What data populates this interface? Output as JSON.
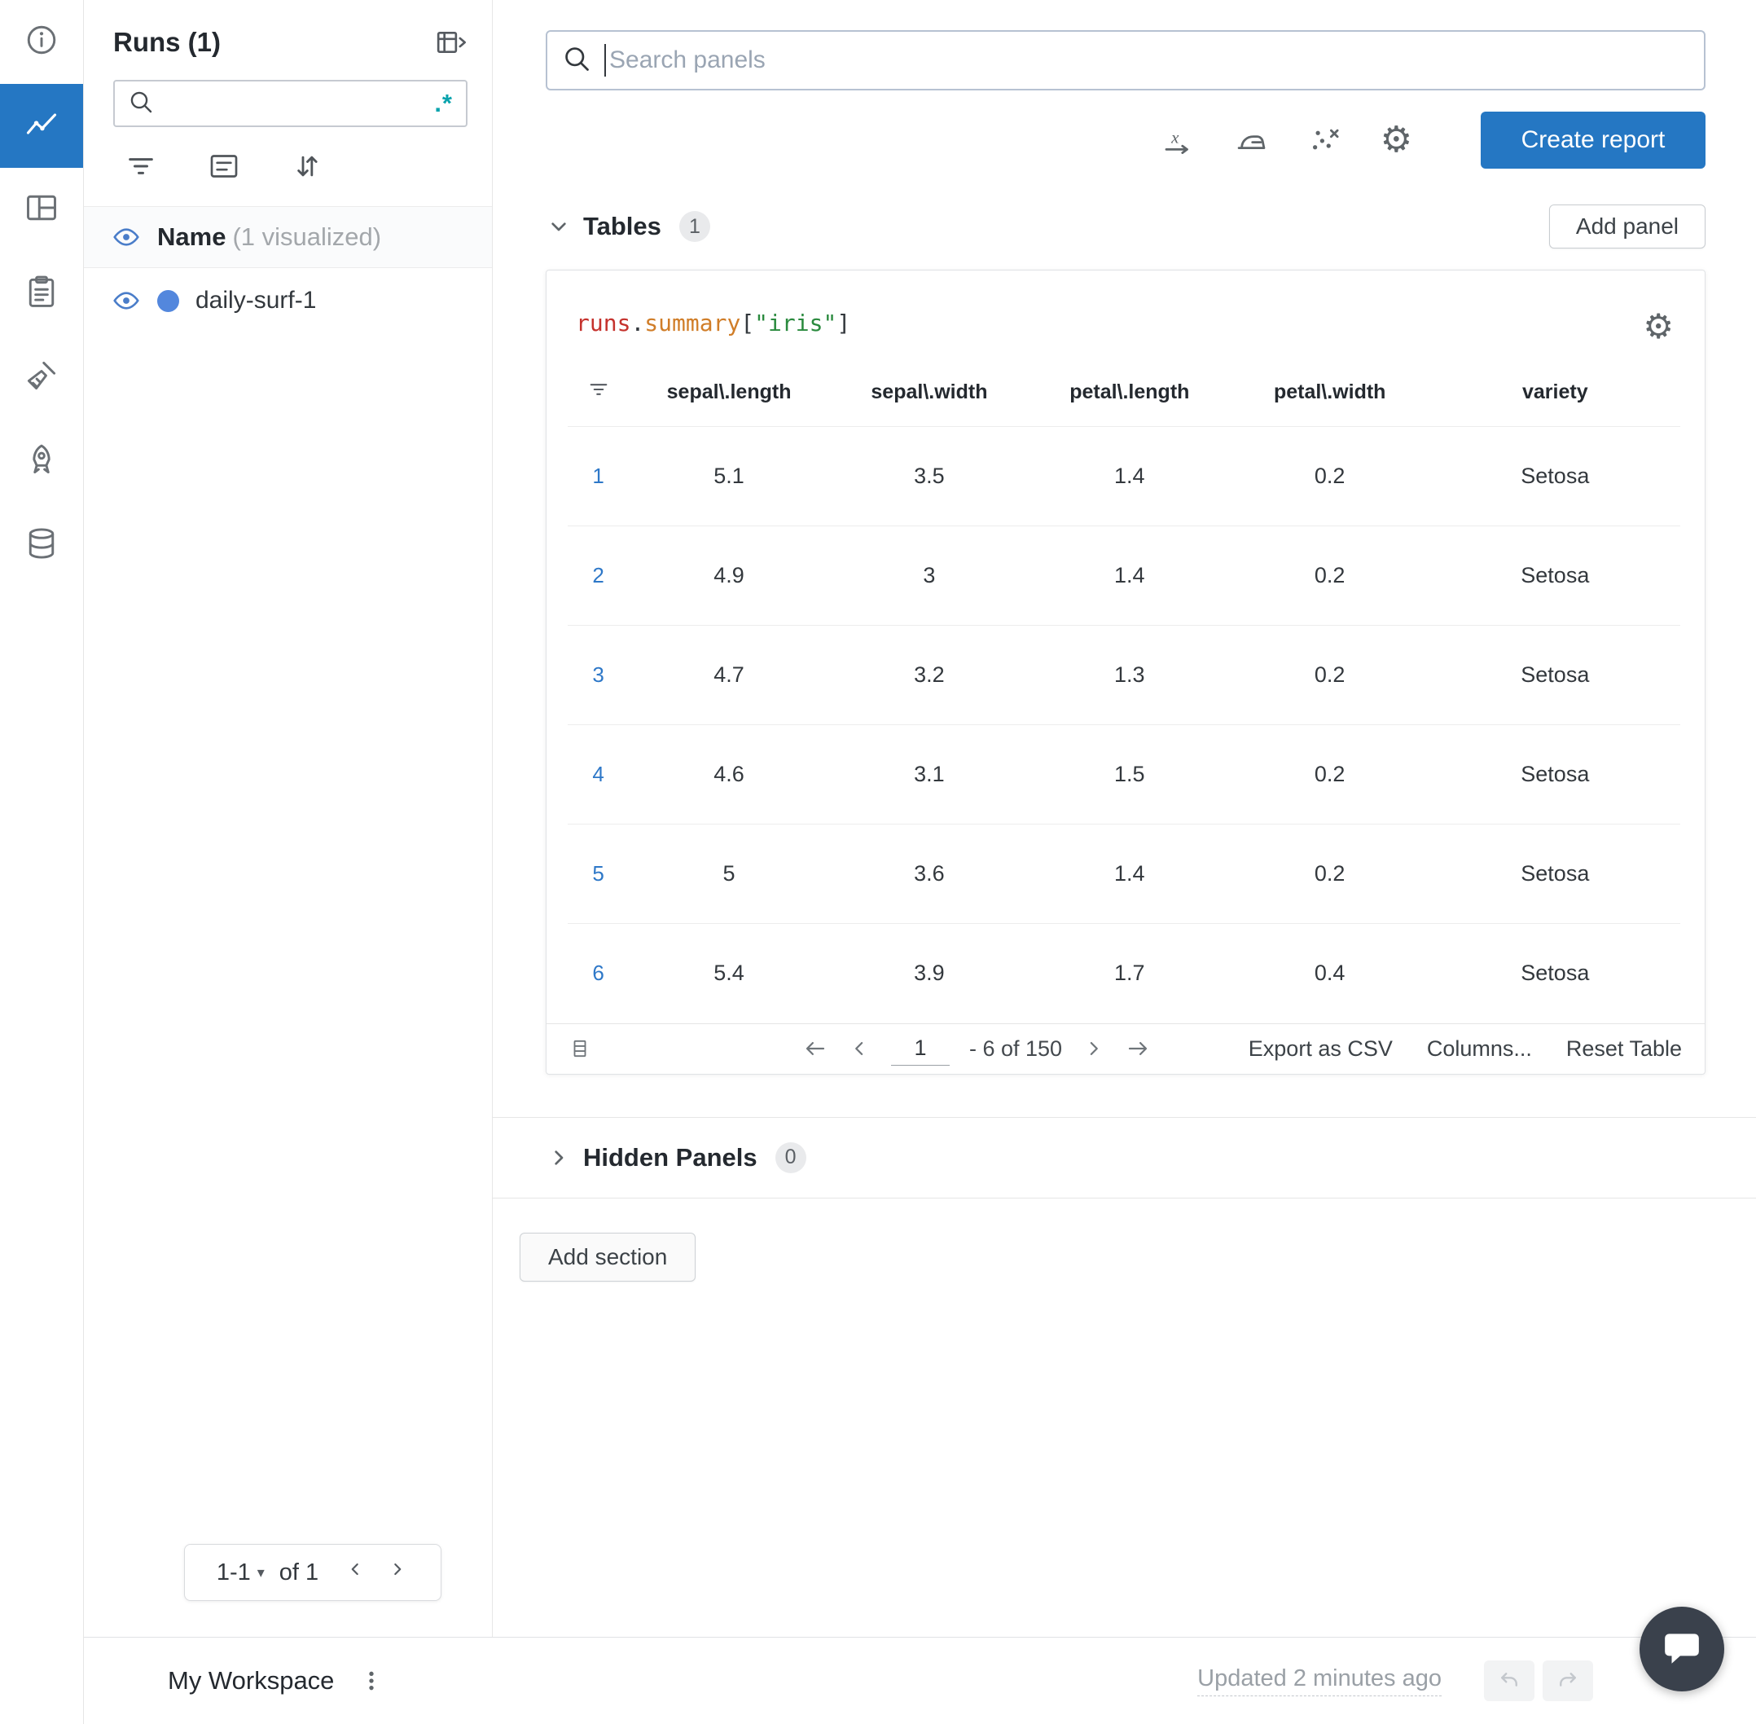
{
  "colors": {
    "accent": "#2577c3",
    "regex_teal": "#09a3ad",
    "run_dot": "#5387dd",
    "code_obj": "#c5322d",
    "code_prop": "#d07d28",
    "code_key": "#2a8a3e"
  },
  "rail": {
    "items": [
      {
        "name": "info"
      },
      {
        "name": "charts",
        "selected": true
      },
      {
        "name": "panels"
      },
      {
        "name": "notes"
      },
      {
        "name": "sweeps"
      },
      {
        "name": "launch"
      },
      {
        "name": "artifacts"
      }
    ]
  },
  "sidebar": {
    "title": "Runs (1)",
    "search_value": "",
    "regex_toggle": ".*",
    "name_header": {
      "label": "Name",
      "annotation": "(1 visualized)"
    },
    "runs": [
      {
        "name": "daily-surf-1"
      }
    ],
    "pagination": {
      "range": "1-1",
      "of_label": "of 1"
    }
  },
  "main": {
    "search_placeholder": "Search panels",
    "create_report_label": "Create report",
    "add_panel_label": "Add panel",
    "tables_section": {
      "label": "Tables",
      "count": "1"
    },
    "hidden_section": {
      "label": "Hidden Panels",
      "count": "0"
    },
    "add_section_label": "Add section"
  },
  "panel": {
    "title": {
      "obj": "runs",
      "dot": ".",
      "prop": "summary",
      "open": "[",
      "key": "\"iris\"",
      "close": "]"
    },
    "table": {
      "columns": [
        "sepal\\.length",
        "sepal\\.width",
        "petal\\.length",
        "petal\\.width",
        "variety"
      ],
      "rows": [
        {
          "i": "1",
          "c": [
            "5.1",
            "3.5",
            "1.4",
            "0.2",
            "Setosa"
          ]
        },
        {
          "i": "2",
          "c": [
            "4.9",
            "3",
            "1.4",
            "0.2",
            "Setosa"
          ]
        },
        {
          "i": "3",
          "c": [
            "4.7",
            "3.2",
            "1.3",
            "0.2",
            "Setosa"
          ]
        },
        {
          "i": "4",
          "c": [
            "4.6",
            "3.1",
            "1.5",
            "0.2",
            "Setosa"
          ]
        },
        {
          "i": "5",
          "c": [
            "5",
            "3.6",
            "1.4",
            "0.2",
            "Setosa"
          ]
        },
        {
          "i": "6",
          "c": [
            "5.4",
            "3.9",
            "1.7",
            "0.4",
            "Setosa"
          ]
        }
      ],
      "footer": {
        "page": "1",
        "range_label": "- 6 of 150",
        "export_label": "Export as CSV",
        "columns_label": "Columns...",
        "reset_label": "Reset Table"
      }
    }
  },
  "bottom_bar": {
    "workspace_label": "My Workspace",
    "updated_label": "Updated 2 minutes ago"
  }
}
